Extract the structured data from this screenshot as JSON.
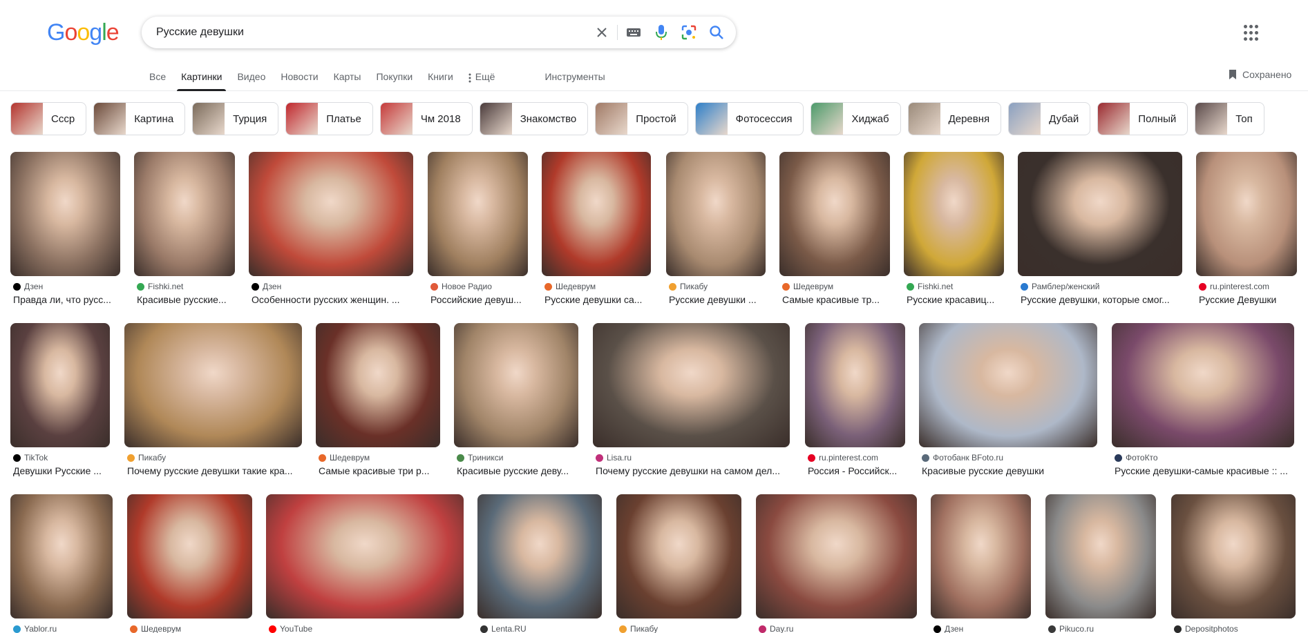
{
  "logo": {
    "letters": [
      "G",
      "o",
      "o",
      "g",
      "l",
      "e"
    ],
    "colors": [
      "#4285f4",
      "#ea4335",
      "#fbbc05",
      "#4285f4",
      "#34a853",
      "#ea4335"
    ]
  },
  "search": {
    "query": "Русские девушки"
  },
  "icons": {
    "clear": "close-icon",
    "keyboard": "keyboard-icon",
    "voice": "mic-icon",
    "lens": "lens-icon",
    "search": "search-icon",
    "apps": "apps-grid-icon",
    "saved": "bookmark-icon"
  },
  "tabs": [
    {
      "label": "Все"
    },
    {
      "label": "Картинки",
      "active": true
    },
    {
      "label": "Видео"
    },
    {
      "label": "Новости"
    },
    {
      "label": "Карты"
    },
    {
      "label": "Покупки"
    },
    {
      "label": "Книги"
    }
  ],
  "tab_more": "Ещё",
  "tab_tools": "Инструменты",
  "saved_label": "Сохранено",
  "chips": [
    {
      "label": "Ссср",
      "color": "#b3342e"
    },
    {
      "label": "Картина",
      "color": "#6b4a3a"
    },
    {
      "label": "Турция",
      "color": "#7a6a5a"
    },
    {
      "label": "Платье",
      "color": "#c0272d"
    },
    {
      "label": "Чм 2018",
      "color": "#c53a3a"
    },
    {
      "label": "Знакомство",
      "color": "#4a3b3b"
    },
    {
      "label": "Простой",
      "color": "#a07a66"
    },
    {
      "label": "Фотосессия",
      "color": "#2f7fc8"
    },
    {
      "label": "Хиджаб",
      "color": "#4c9a6a"
    },
    {
      "label": "Деревня",
      "color": "#9a8a7a"
    },
    {
      "label": "Дубай",
      "color": "#8aa0c0"
    },
    {
      "label": "Полный",
      "color": "#9a2a30"
    },
    {
      "label": "Топ",
      "color": "#5a4a4a"
    }
  ],
  "results": [
    [
      {
        "source": "Дзен",
        "title": "Правда ли, что русс...",
        "color": "#8a7060",
        "fav": "#000000"
      },
      {
        "source": "Fishki.net",
        "title": "Красивые русские...",
        "color": "#9a7a68",
        "fav": "#34a853"
      },
      {
        "source": "Дзен",
        "title": "Особенности русских женщин. ...",
        "color": "#c04a3a",
        "fav": "#000000"
      },
      {
        "source": "Новое Радио",
        "title": "Российские девуш...",
        "color": "#a08060",
        "fav": "#e05a3a"
      },
      {
        "source": "Шедеврум",
        "title": "Русские девушки са...",
        "color": "#b03a2a",
        "fav": "#e8682a"
      },
      {
        "source": "Пикабу",
        "title": "Русские девушки ...",
        "color": "#a88a70",
        "fav": "#f0a030"
      },
      {
        "source": "Шедеврум",
        "title": "Самые красивые тр...",
        "color": "#7a5a48",
        "fav": "#e8682a"
      },
      {
        "source": "Fishki.net",
        "title": "Русские красавиц...",
        "color": "#d0a838",
        "fav": "#34a853"
      },
      {
        "source": "Рамблер/женский",
        "title": "Русские девушки, которые смог...",
        "color": "#3a302c",
        "fav": "#2a7ad0"
      },
      {
        "source": "ru.pinterest.com",
        "title": "Русские Девушки",
        "color": "#b8907a",
        "fav": "#e60023"
      }
    ],
    [
      {
        "source": "TikTok",
        "title": "Девушки Русские ...",
        "color": "#5a4040",
        "fav": "#000000"
      },
      {
        "source": "Пикабу",
        "title": "Почему русские девушки такие кра...",
        "color": "#b08858",
        "fav": "#f0a030"
      },
      {
        "source": "Шедеврум",
        "title": "Самые красивые три р...",
        "color": "#6a3028",
        "fav": "#e8682a"
      },
      {
        "source": "Триникси",
        "title": "Красивые русские деву...",
        "color": "#a08468",
        "fav": "#4a8a4a"
      },
      {
        "source": "Lisa.ru",
        "title": "Почему русские девушки на самом дел...",
        "color": "#5a5048",
        "fav": "#c0307a"
      },
      {
        "source": "ru.pinterest.com",
        "title": "Россия - Российск...",
        "color": "#7a6078",
        "fav": "#e60023"
      },
      {
        "source": "Фотобанк BFoto.ru",
        "title": "Красивые русские девушки",
        "color": "#aeb8c8",
        "fav": "#5a6a7a"
      },
      {
        "source": "ФотоКто",
        "title": "Русские девушки-самые красивые :: ...",
        "color": "#7a4a6a",
        "fav": "#2a3a5a"
      }
    ],
    [
      {
        "source": "Yablor.ru",
        "title": "",
        "color": "#8a6a50",
        "fav": "#2a9ad0"
      },
      {
        "source": "Шедеврум",
        "title": "",
        "color": "#b03a2a",
        "fav": "#e8682a"
      },
      {
        "source": "YouTube",
        "title": "",
        "color": "#c04040",
        "fav": "#ff0000"
      },
      {
        "source": "Lenta.RU",
        "title": "",
        "color": "#5a6a78",
        "fav": "#333333"
      },
      {
        "source": "Пикабу",
        "title": "",
        "color": "#6a4030",
        "fav": "#f0a030"
      },
      {
        "source": "Day.ru",
        "title": "",
        "color": "#8a4a40",
        "fav": "#c02a6a"
      },
      {
        "source": "Дзен",
        "title": "",
        "color": "#a07060",
        "fav": "#000000"
      },
      {
        "source": "Pikuco.ru",
        "title": "",
        "color": "#8a8a8a",
        "fav": "#3a3a3a"
      },
      {
        "source": "Depositphotos",
        "title": "",
        "color": "#6a5040",
        "fav": "#2a2a2a"
      }
    ]
  ]
}
